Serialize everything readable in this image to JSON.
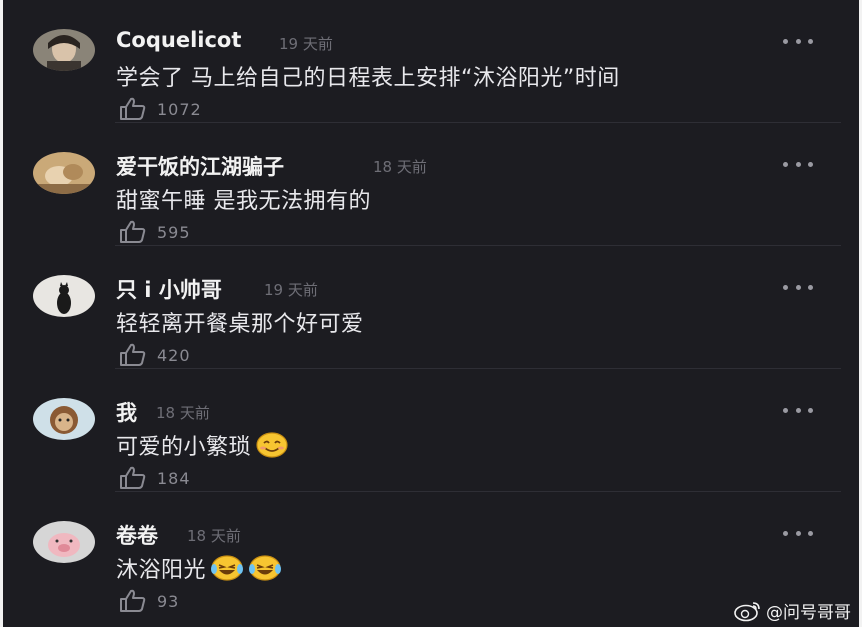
{
  "comments": [
    {
      "username": "Coquelicot",
      "time": "19 天前",
      "text": "学会了 马上给自己的日程表上安排“沐浴阳光”时间",
      "likes": "1072",
      "emoji_count": 0
    },
    {
      "username": "爱干饭的江湖骗子",
      "time": "18 天前",
      "text": "甜蜜午睡 是我无法拥有的",
      "likes": "595",
      "emoji_count": 0
    },
    {
      "username": "只 i 小帅哥",
      "time": "19 天前",
      "text": "轻轻离开餐桌那个好可爱",
      "likes": "420",
      "emoji_count": 0
    },
    {
      "username": "我",
      "time": "18 天前",
      "text": "可爱的小繁琐",
      "likes": "184",
      "emoji_count": 1
    },
    {
      "username": "卷卷",
      "time": "18 天前",
      "text": "沐浴阳光",
      "likes": "93",
      "emoji_count": 2
    }
  ],
  "watermark": "@问号哥哥",
  "colors": {
    "background": "#1c1c21",
    "username": "#f2f2f2",
    "time": "#6e6e76",
    "text": "#e8e8ec"
  }
}
